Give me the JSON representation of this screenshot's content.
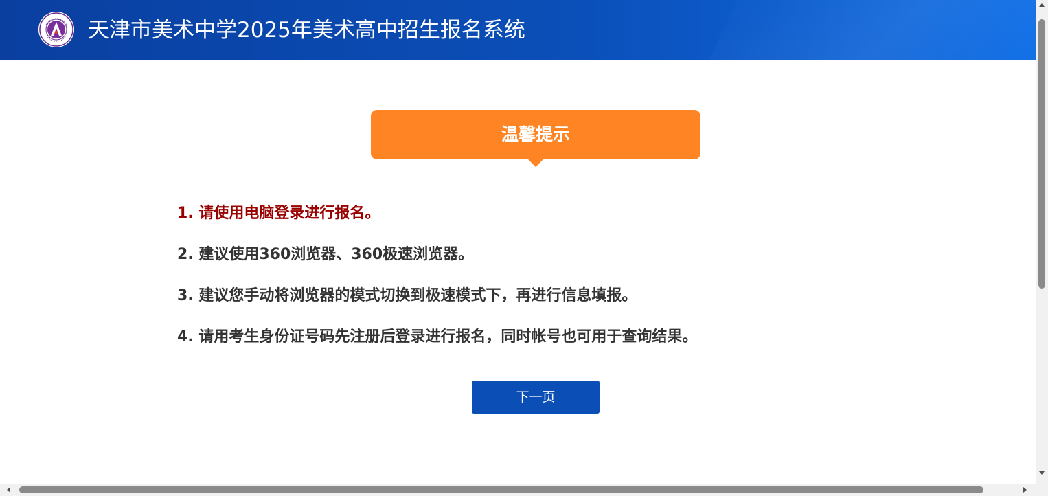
{
  "header": {
    "title": "天津市美术中学2025年美术高中招生报名系统",
    "logo_icon": "school-emblem-icon"
  },
  "tip": {
    "title": "温馨提示"
  },
  "notices": [
    {
      "text": "1. 请使用电脑登录进行报名。"
    },
    {
      "text": "2. 建议使用360浏览器、360极速浏览器。"
    },
    {
      "text": "3. 建议您手动将浏览器的模式切换到极速模式下，再进行信息填报。"
    },
    {
      "text": "4. 请用考生身份证号码先注册后登录进行报名，同时帐号也可用于查询结果。"
    }
  ],
  "actions": {
    "next_label": "下一页"
  },
  "colors": {
    "header_blue": "#0b4fb8",
    "tip_orange": "#ff8524",
    "warning_red": "#990000",
    "text_dark": "#333333",
    "button_blue": "#0b4fb6"
  }
}
